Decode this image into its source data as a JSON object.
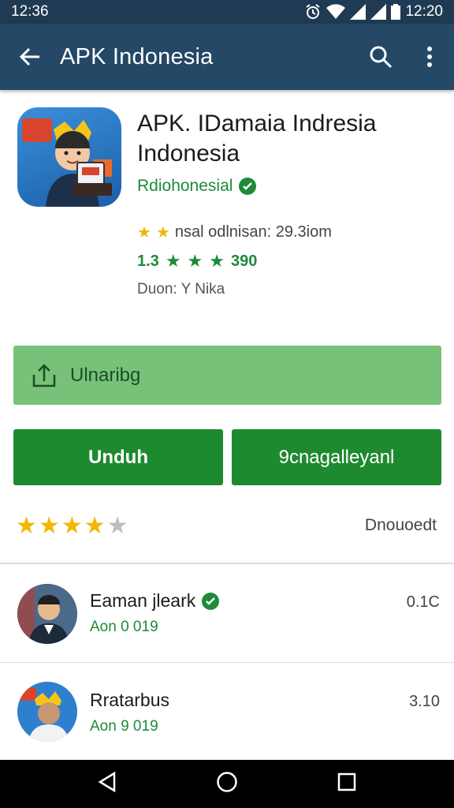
{
  "status_bar": {
    "time": "12:36",
    "battery_time": "12:20"
  },
  "app_bar": {
    "title": "APK Indonesia"
  },
  "app": {
    "name": "APK. IDamaia Indresia Indonesia",
    "developer": "Rdiohonesial",
    "meta_line1": "nsal odlnisan: 29.3iom",
    "rating_value": "1.3",
    "rating_count": "390",
    "meta_line3": "Duon: Y Nika"
  },
  "install_bar": {
    "label": "Ulnaribg"
  },
  "buttons": {
    "left_label": "Unduh",
    "right_label": "9cnagalleyanl"
  },
  "rating": {
    "stars": 4,
    "link_label": "Dnouoedt"
  },
  "list": [
    {
      "title": "Eaman jleark",
      "verified": true,
      "subtitle": "Aon 0 019",
      "value": "0.1C"
    },
    {
      "title": "Rratarbus",
      "verified": false,
      "subtitle": "Aon 9 019",
      "value": "3.10"
    }
  ],
  "colors": {
    "app_bar": "#244866",
    "accent_green": "#1e8a30",
    "install_bar": "#78c178",
    "star": "#f2b705"
  }
}
